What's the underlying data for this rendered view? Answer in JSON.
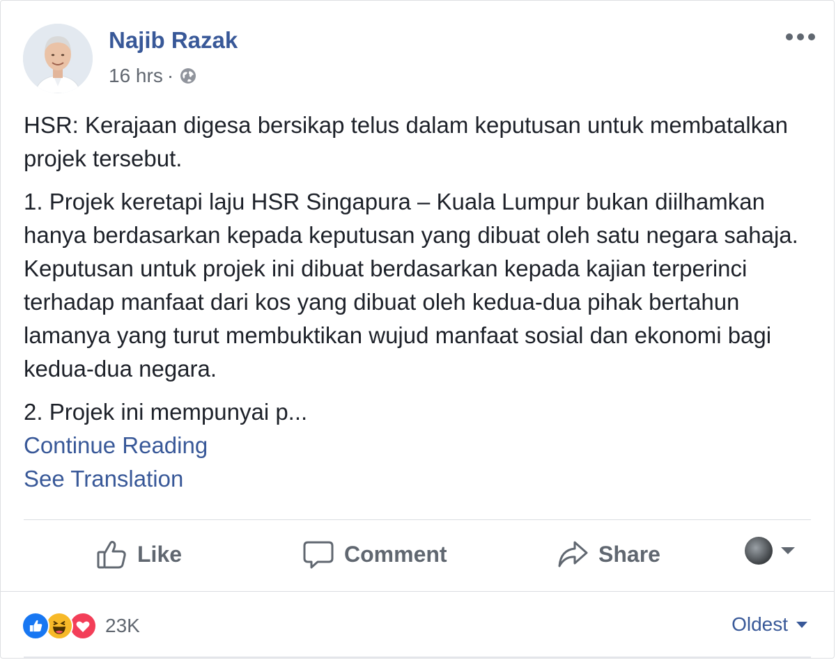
{
  "post": {
    "author": "Najib Razak",
    "time": "16 hrs",
    "separator": "·",
    "privacy_icon": "globe-icon",
    "more_icon": "more-options-icon",
    "paragraphs": [
      "HSR: Kerajaan digesa bersikap telus dalam keputusan untuk membatalkan projek tersebut.",
      "1. Projek keretapi laju HSR Singapura – Kuala Lumpur bukan diilhamkan hanya berdasarkan kepada keputusan yang dibuat oleh satu negara sahaja. Keputusan untuk projek ini dibuat berdasarkan kepada kajian terperinci terhadap manfaat dari kos yang dibuat oleh kedua-dua pihak bertahun lamanya yang turut membuktikan wujud manfaat sosial dan ekonomi bagi kedua-dua negara.",
      "2. Projek ini mempunyai p..."
    ],
    "continue_reading": "Continue Reading",
    "see_translation": "See Translation"
  },
  "actions": {
    "like": "Like",
    "comment": "Comment",
    "share": "Share"
  },
  "reactions": {
    "types": [
      "like",
      "haha",
      "love"
    ],
    "count": "23K"
  },
  "comments": {
    "sort_label": "Oldest"
  },
  "colors": {
    "link": "#385898",
    "action_text": "#606770",
    "like_blue": "#1877f2",
    "haha_yellow": "#f7b928",
    "love_red": "#f33e58"
  }
}
